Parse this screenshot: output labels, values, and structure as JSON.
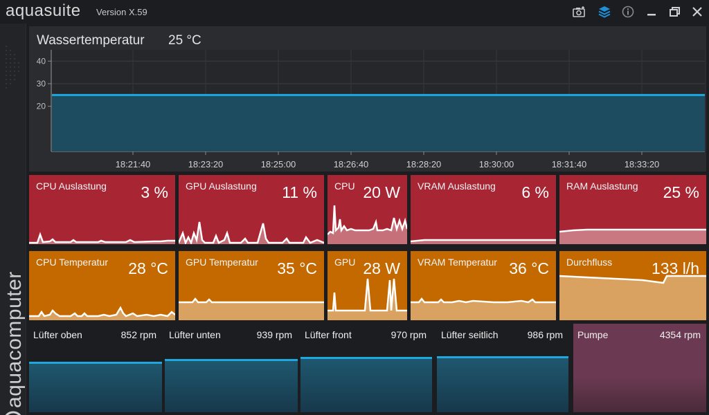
{
  "app": {
    "name": "aquasuite",
    "version": "Version X.59",
    "brand": "aquacomputer"
  },
  "titlebar": {
    "icons": [
      "camera-icon",
      "layers-icon",
      "info-icon",
      "minimize-icon",
      "maximize-icon",
      "close-icon"
    ],
    "accent": "#1e90d8"
  },
  "water": {
    "title": "Wassertemperatur",
    "value": "25 °C",
    "y_ticks": [
      "40",
      "30",
      "20"
    ],
    "x_ticks": [
      "18:21:40",
      "18:23:20",
      "18:25:00",
      "18:26:40",
      "18:28:20",
      "18:30:00",
      "18:31:40",
      "18:33:20"
    ],
    "chart_data": {
      "type": "area",
      "x": [
        "18:21:40",
        "18:23:20",
        "18:25:00",
        "18:26:40",
        "18:28:20",
        "18:30:00",
        "18:31:40",
        "18:33:20"
      ],
      "values": [
        25,
        25,
        25,
        25,
        25,
        25,
        25,
        25
      ],
      "ylim": [
        0,
        45
      ],
      "grid": true,
      "color": "#1ea8e0"
    }
  },
  "row1": [
    {
      "label": "CPU Auslastung",
      "value": "3 %"
    },
    {
      "label": "GPU Auslastung",
      "value": "11 %"
    },
    {
      "label": "CPU",
      "value": "20 W"
    },
    {
      "label": "VRAM Auslastung",
      "value": "6 %"
    },
    {
      "label": "RAM Auslastung",
      "value": "25 %"
    }
  ],
  "row2": [
    {
      "label": "CPU Temperatur",
      "value": "28 °C"
    },
    {
      "label": "GPU Temperatur",
      "value": "35 °C"
    },
    {
      "label": "GPU",
      "value": "28 W"
    },
    {
      "label": "VRAM Temperatur",
      "value": "36 °C"
    },
    {
      "label": "Durchfluss",
      "value": "133 l/h"
    }
  ],
  "fans": [
    {
      "label": "Lüfter oben",
      "value": "852 rpm"
    },
    {
      "label": "Lüfter unten",
      "value": "939 rpm"
    },
    {
      "label": "Lüfter front",
      "value": "970 rpm"
    },
    {
      "label": "Lüfter seitlich",
      "value": "986 rpm"
    },
    {
      "label": "Pumpe",
      "value": "4354 rpm"
    }
  ],
  "colors": {
    "red_tile": "#a82634",
    "orange_tile": "#c46900",
    "fan_line": "#1ea8e0",
    "pump_tile": "#6b3a52"
  }
}
